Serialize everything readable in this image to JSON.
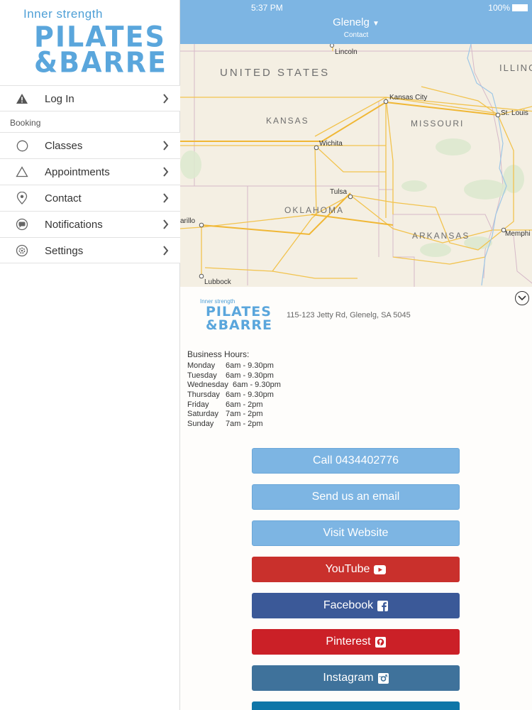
{
  "sidebar": {
    "logo": {
      "tagline": "Inner strength",
      "line1": "PILATES",
      "line2": "&BARRE"
    },
    "login_label": "Log In",
    "section_booking": "Booking",
    "items": [
      {
        "label": "Classes",
        "icon": "circle-icon"
      },
      {
        "label": "Appointments",
        "icon": "triangle-icon"
      },
      {
        "label": "Contact",
        "icon": "location-pin-icon"
      },
      {
        "label": "Notifications",
        "icon": "chat-bubble-icon"
      },
      {
        "label": "Settings",
        "icon": "gear-icon"
      }
    ]
  },
  "status": {
    "time": "5:37 PM",
    "battery": "100%"
  },
  "header": {
    "title": "Glenelg",
    "subtitle": "Contact"
  },
  "map": {
    "labels": {
      "us": "UNITED STATES",
      "illinois": "ILLING",
      "kansas": "KANSAS",
      "missouri": "MISSOURI",
      "oklahoma": "OKLAHOMA",
      "arkansas": "ARKANSAS",
      "lincoln": "Lincoln",
      "kansas_city": "Kansas City",
      "st_louis": "St. Louis",
      "wichita": "Wichita",
      "tulsa": "Tulsa",
      "amarillo": "arillo",
      "lubbock": "Lubbock",
      "memphis": "Memphi"
    }
  },
  "panel": {
    "logo": {
      "tagline": "Inner strength",
      "line1": "PILATES",
      "line2": "&BARRE"
    },
    "address": "115-123 Jetty Rd, Glenelg, SA 5045",
    "hours_title": "Business Hours:",
    "hours": [
      {
        "day": "Monday",
        "time": "6am - 9.30pm"
      },
      {
        "day": "Tuesday",
        "time": "6am - 9.30pm"
      },
      {
        "day": "Wednesday",
        "time": "6am - 9.30pm"
      },
      {
        "day": "Thursday",
        "time": "6am - 9.30pm"
      },
      {
        "day": "Friday",
        "time": "6am - 2pm"
      },
      {
        "day": "Saturday",
        "time": "7am - 2pm"
      },
      {
        "day": "Sunday",
        "time": "7am - 2pm"
      }
    ]
  },
  "buttons": {
    "call": "Call 0434402776",
    "email": "Send us an email",
    "website": "Visit Website",
    "youtube": "YouTube",
    "facebook": "Facebook",
    "pinterest": "Pinterest",
    "instagram": "Instagram"
  },
  "colors": {
    "nav_blue": "#7db5e3",
    "action_blue": "#7db5e3",
    "youtube": "#c9302c",
    "facebook": "#3b5998",
    "pinterest": "#cb2027",
    "instagram": "#3f729b",
    "linkedin": "#0e76a8"
  }
}
